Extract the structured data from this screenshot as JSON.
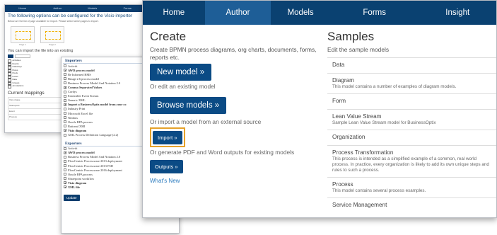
{
  "back_window": {
    "nav": [
      "Home",
      "Author",
      "Models",
      "Forms"
    ],
    "title": "The following options can be configured for the Visio importer",
    "small_text": "Below are the list of page available for import. Please select which pages to import.",
    "thumbs": [
      "Page 1",
      "Page 2"
    ],
    "import_text": "You can import the file into an existing",
    "mapping_title": "Current mappings",
    "mapping_rows": [
      "Visio shape",
      "Sharepoint",
      "Event",
      "Process"
    ],
    "file_items": [
      "Activities",
      "Events",
      "Gateways",
      "Flows",
      "Pools",
      "Lanes",
      "Data",
      "Groups",
      "Annotations"
    ]
  },
  "importers": {
    "title": "Importers",
    "items": [
      {
        "label": "Activiti",
        "checked": false
      },
      {
        "label": "AWD process model",
        "checked": true
      },
      {
        "label": "Be Informed BMS",
        "checked": false
      },
      {
        "label": "Bizagi 2.6 process model",
        "checked": false
      },
      {
        "label": "Business Process Model And Notation 2.0",
        "checked": false
      },
      {
        "label": "Comma Separated Values",
        "checked": true
      },
      {
        "label": "Cordys",
        "checked": false
      },
      {
        "label": "Extensible Event Stream",
        "checked": false
      },
      {
        "label": "Generic XML",
        "checked": false
      },
      {
        "label": "Import a BusinessOptix model from your co",
        "checked": true
      },
      {
        "label": "Industry Print",
        "checked": false
      },
      {
        "label": "Microsoft Excel file",
        "checked": false
      },
      {
        "label": "Nimbus",
        "checked": false
      },
      {
        "label": "Oracle BPA process",
        "checked": false
      },
      {
        "label": "Rational XMI",
        "checked": false
      },
      {
        "label": "Visio diagram",
        "checked": true
      },
      {
        "label": "XML Process Definition Language (2.2)",
        "checked": false
      }
    ]
  },
  "exporters": {
    "title": "Exporters",
    "items": [
      {
        "label": "Activiti",
        "checked": false
      },
      {
        "label": "AWD process model",
        "checked": true
      },
      {
        "label": "Business Process Model And Notation 2.0",
        "checked": false
      },
      {
        "label": "FlowCentric Processware 2013 deployment",
        "checked": false
      },
      {
        "label": "FlowCentric Processware 2013 FSD",
        "checked": false
      },
      {
        "label": "FlowCentric Processware 2016 deployment",
        "checked": false
      },
      {
        "label": "Oracle BPA process",
        "checked": false
      },
      {
        "label": "Sharepoint workflow",
        "checked": false
      },
      {
        "label": "Visio diagram",
        "checked": true
      },
      {
        "label": "XML file",
        "checked": true
      }
    ],
    "update_label": "Update"
  },
  "front": {
    "nav": [
      "Home",
      "Author",
      "Models",
      "Forms",
      "Insight"
    ],
    "active_nav": "Author",
    "create": {
      "title": "Create",
      "desc": "Create BPMN process diagrams, org charts, documents, forms, reports etc.",
      "new_model": "New model »",
      "or_edit": "Or edit an existing model",
      "browse": "Browse models »",
      "or_import": "Or import a model from an external source",
      "import": "Import »",
      "or_generate": "Or generate PDF and Word outputs for existing models",
      "outputs": "Outputs »",
      "whats_new": "What's New"
    },
    "samples": {
      "title": "Samples",
      "desc": "Edit the sample models",
      "items": [
        {
          "title": "Data",
          "desc": ""
        },
        {
          "title": "Diagram",
          "desc": "This model contains a number of examples of diagram models."
        },
        {
          "title": "Form",
          "desc": ""
        },
        {
          "title": "Lean Value Stream",
          "desc": "Sample Lean Value Stream model for BusinessOptix"
        },
        {
          "title": "Organization",
          "desc": ""
        },
        {
          "title": "Process Transformation",
          "desc": "This process is intended as a simplified example of a common, real world process. In practice, every organization is likely to add its own unique steps and rules to such a process."
        },
        {
          "title": "Process",
          "desc": "This model contains several process examples."
        },
        {
          "title": "Service Management",
          "desc": ""
        }
      ]
    },
    "colors": {
      "nav_bg": "#0a4171",
      "nav_active": "#1e5e97",
      "button": "#0b4b85",
      "highlight": "#e5a22b",
      "link": "#2b7bbf"
    }
  }
}
